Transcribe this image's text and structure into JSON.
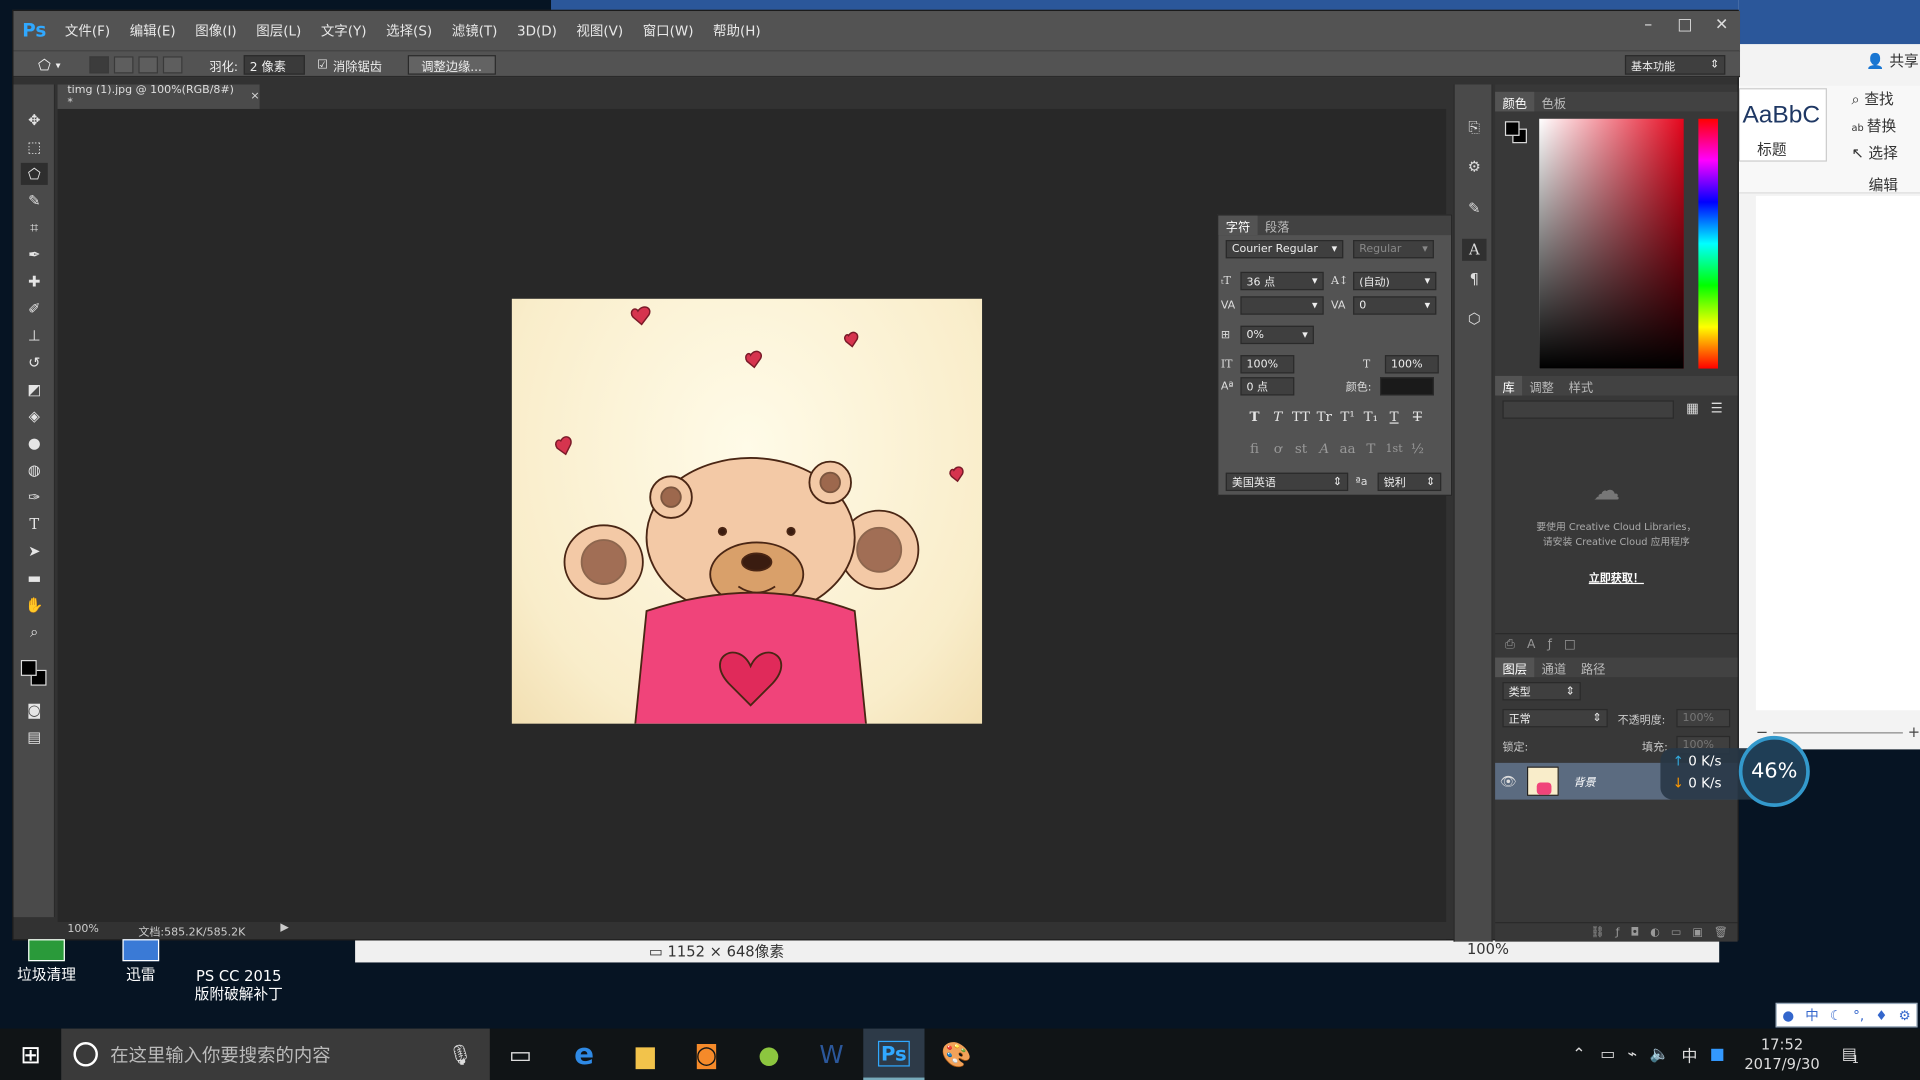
{
  "menu": {
    "logo": "Ps",
    "items": [
      "文件(F)",
      "编辑(E)",
      "图像(I)",
      "图层(L)",
      "文字(Y)",
      "选择(S)",
      "滤镜(T)",
      "3D(D)",
      "视图(V)",
      "窗口(W)",
      "帮助(H)"
    ],
    "win_min": "–",
    "win_max": "□",
    "win_close": "✕"
  },
  "options": {
    "feather_label": "羽化:",
    "feather_value": "2 像素",
    "antialias_label": "消除锯齿",
    "refine_edge": "调整边缘...",
    "workspace": "基本功能"
  },
  "document": {
    "tab_title": "timg (1).jpg @ 100%(RGB/8#) *",
    "tab_close": "×",
    "zoom": "100%",
    "doc_info": "文档:585.2K/585.2K"
  },
  "color_panel": {
    "tab_color": "颜色",
    "tab_swatches": "色板"
  },
  "libraries_panel": {
    "tab_libraries": "库",
    "tab_adjust": "调整",
    "tab_styles": "样式",
    "message_line1": "要使用 Creative Cloud Libraries，",
    "message_line2": "请安装 Creative Cloud 应用程序",
    "install_link": "立即获取！"
  },
  "layers_panel": {
    "tab_layers": "图层",
    "tab_channels": "通道",
    "tab_paths": "路径",
    "filter_kind": "类型",
    "blend_mode": "正常",
    "opacity_label": "不透明度:",
    "opacity_value": "100%",
    "lock_label": "锁定:",
    "fill_label": "填充:",
    "fill_value": "100%",
    "layer_name": "背景"
  },
  "character_panel": {
    "tab_character": "字符",
    "tab_paragraph": "段落",
    "font_family": "Courier Regular",
    "font_style": "Regular",
    "font_size": "36 点",
    "leading": "(自动)",
    "kerning": "",
    "tracking": "0",
    "tsume": "0%",
    "vertical_scale": "100%",
    "horizontal_scale": "100%",
    "baseline_shift": "0 点",
    "color_label": "颜色:",
    "style_glyphs": [
      "T",
      "T",
      "TT",
      "Tr",
      "T¹",
      "T₁",
      "T",
      "T"
    ],
    "opentype_glyphs": [
      "ﬁ",
      "ơ",
      "st",
      "A",
      "aa",
      "T",
      "1st",
      "½"
    ],
    "language": "美国英语",
    "aa_icon": "ªa",
    "antialias": "锐利"
  },
  "word": {
    "style_preview": "AaBbC",
    "style_name": "标题",
    "find": "查找",
    "replace": "替换",
    "select": "选择",
    "group_edit": "编辑",
    "share": "共享",
    "status_size": "1152 × 648像素",
    "status_zoom": "100%"
  },
  "desktop": {
    "icon1": "垃圾清理",
    "icon2": "迅雷",
    "icon3_line1": "PS CC 2015",
    "icon3_line2": "版附破解补丁"
  },
  "net_widget": {
    "up": "0 K/s",
    "down": "0 K/s",
    "percent": "46%"
  },
  "taskbar": {
    "search_placeholder": "在这里输入你要搜索的内容",
    "ime": "中",
    "time": "17:52",
    "date": "2017/9/30",
    "notification_count": "1",
    "ps_label": "Ps"
  },
  "colors": {
    "ps_blue": "#30a8ff",
    "shirt_pink": "#f0447a",
    "heart_red": "#d6344e"
  }
}
